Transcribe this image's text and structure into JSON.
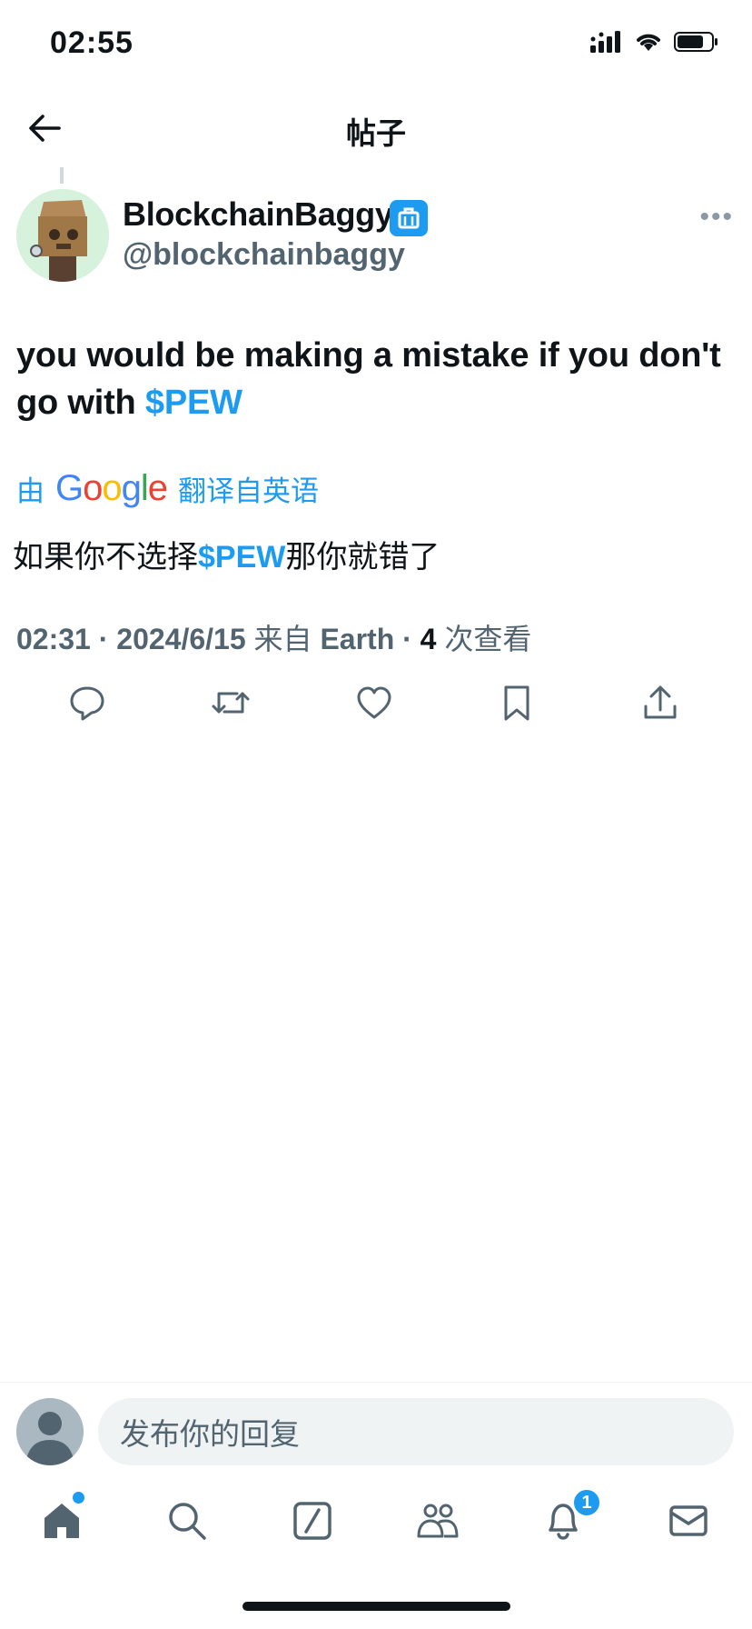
{
  "status_bar": {
    "time": "02:55"
  },
  "header": {
    "title": "帖子"
  },
  "tweet": {
    "author_name": "BlockchainBaggy",
    "author_handle": "@blockchainbaggy",
    "text_before_cashtag": "you would be making a mistake if you don't go with ",
    "cashtag": "$PEW",
    "translation": {
      "prefix": "由",
      "provider": "Google",
      "suffix": "翻译自英语",
      "text_before_cashtag": "如果你不选择",
      "cashtag": "$PEW",
      "text_after_cashtag": "那你就错了"
    },
    "meta": {
      "time": "02:31",
      "date": "2024/6/15",
      "source_prefix": "来自",
      "source": "Earth",
      "view_count": "4",
      "view_label": "次查看"
    }
  },
  "reply": {
    "placeholder": "发布你的回复"
  },
  "tab_bar": {
    "notification_count": "1"
  },
  "colors": {
    "accent": "#1d9bf0",
    "text": "#0f1419",
    "secondary": "#536471"
  }
}
